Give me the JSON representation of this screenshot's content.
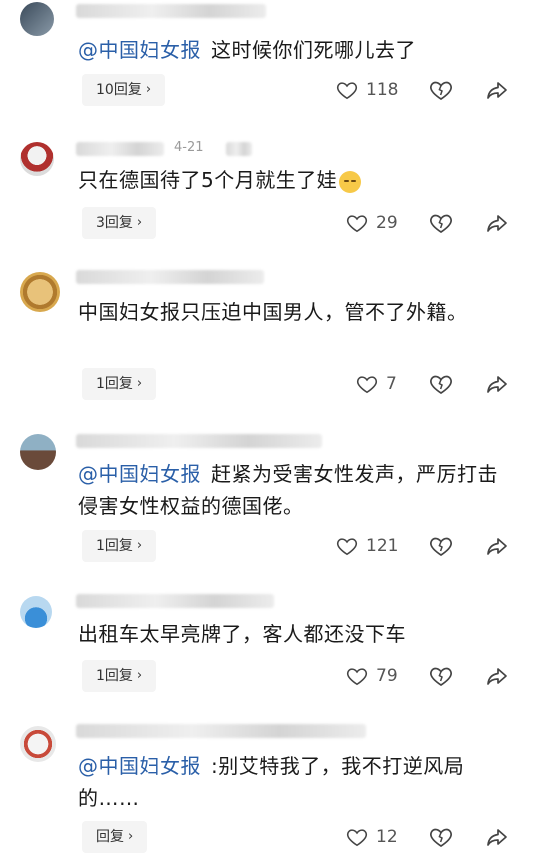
{
  "comments": [
    {
      "mention": "@中国妇女报",
      "text": "这时候你们死哪儿去了",
      "reply": "10回复",
      "likes": "118"
    },
    {
      "date": "4-21",
      "mention": "",
      "text": "只在德国待了5个月就生了娃",
      "reply": "3回复",
      "likes": "29"
    },
    {
      "mention": "",
      "text": "中国妇女报只压迫中国男人，管不了外籍。",
      "reply": "1回复",
      "likes": "7"
    },
    {
      "mention": "@中国妇女报",
      "text": "赶紧为受害女性发声，严厉打击侵害女性权益的德国佬。",
      "reply": "1回复",
      "likes": "121"
    },
    {
      "mention": "",
      "text": "出租车太早亮牌了，客人都还没下车",
      "reply": "1回复",
      "likes": "79"
    },
    {
      "mention": "@中国妇女报",
      "text": ":别艾特我了，我不打逆风局的……",
      "reply": "回复",
      "likes": "12"
    }
  ],
  "icons": {
    "like": "heart-outline-icon",
    "dislike": "broken-heart-icon",
    "share": "share-arrow-icon",
    "reply_chevron": "chevron-right-icon"
  },
  "colors": {
    "mention": "#2a5fa8",
    "reply_bg": "#f4f4f4",
    "icon": "#444444"
  }
}
